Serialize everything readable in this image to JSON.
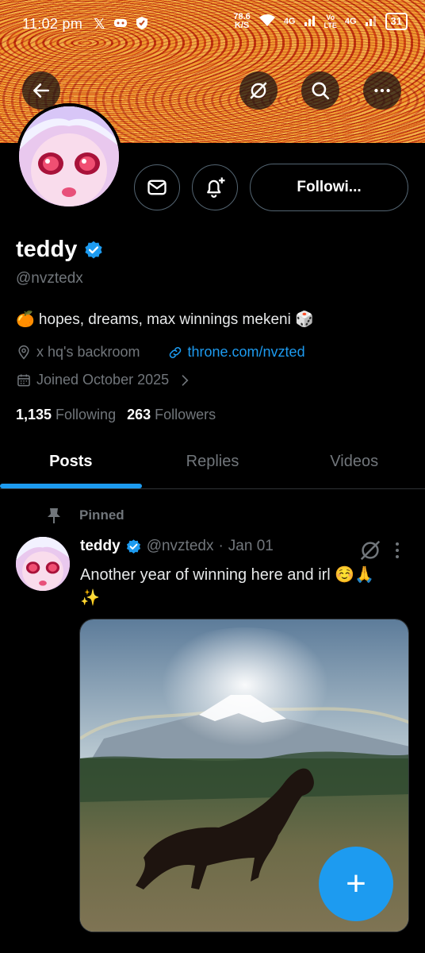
{
  "status_bar": {
    "time": "11:02 pm",
    "net_speed": "78.6",
    "net_unit": "K/S",
    "net1": "4G",
    "net2_a": "Vo",
    "net2_b": "LTE",
    "net3": "4G",
    "battery": "31"
  },
  "header": {
    "back_icon": "arrow-left-icon",
    "grok_icon": "grok-icon",
    "search_icon": "search-icon",
    "more_icon": "more-icon"
  },
  "profile": {
    "name": "teddy",
    "handle": "@nvztedx",
    "bio": "🍊 hopes, dreams, max winnings mekeni 🎲",
    "location": "x hq's backroom",
    "website": "throne.com/nvzted",
    "joined": "Joined October 2025",
    "following_count": "1,135",
    "following_label": "Following",
    "followers_count": "263",
    "followers_label": "Followers",
    "follow_button": "Followi..."
  },
  "tabs": [
    "Posts",
    "Replies",
    "Videos"
  ],
  "post": {
    "pinned_label": "Pinned",
    "author": "teddy",
    "handle": "@nvztedx",
    "dot": "·",
    "date": "Jan 01",
    "text": "Another year of winning here and irl ☺️🙏",
    "text2": "✨"
  },
  "fab_label": "+",
  "colors": {
    "accent": "#1d9bf0",
    "background": "#000000",
    "muted": "#71767b"
  }
}
